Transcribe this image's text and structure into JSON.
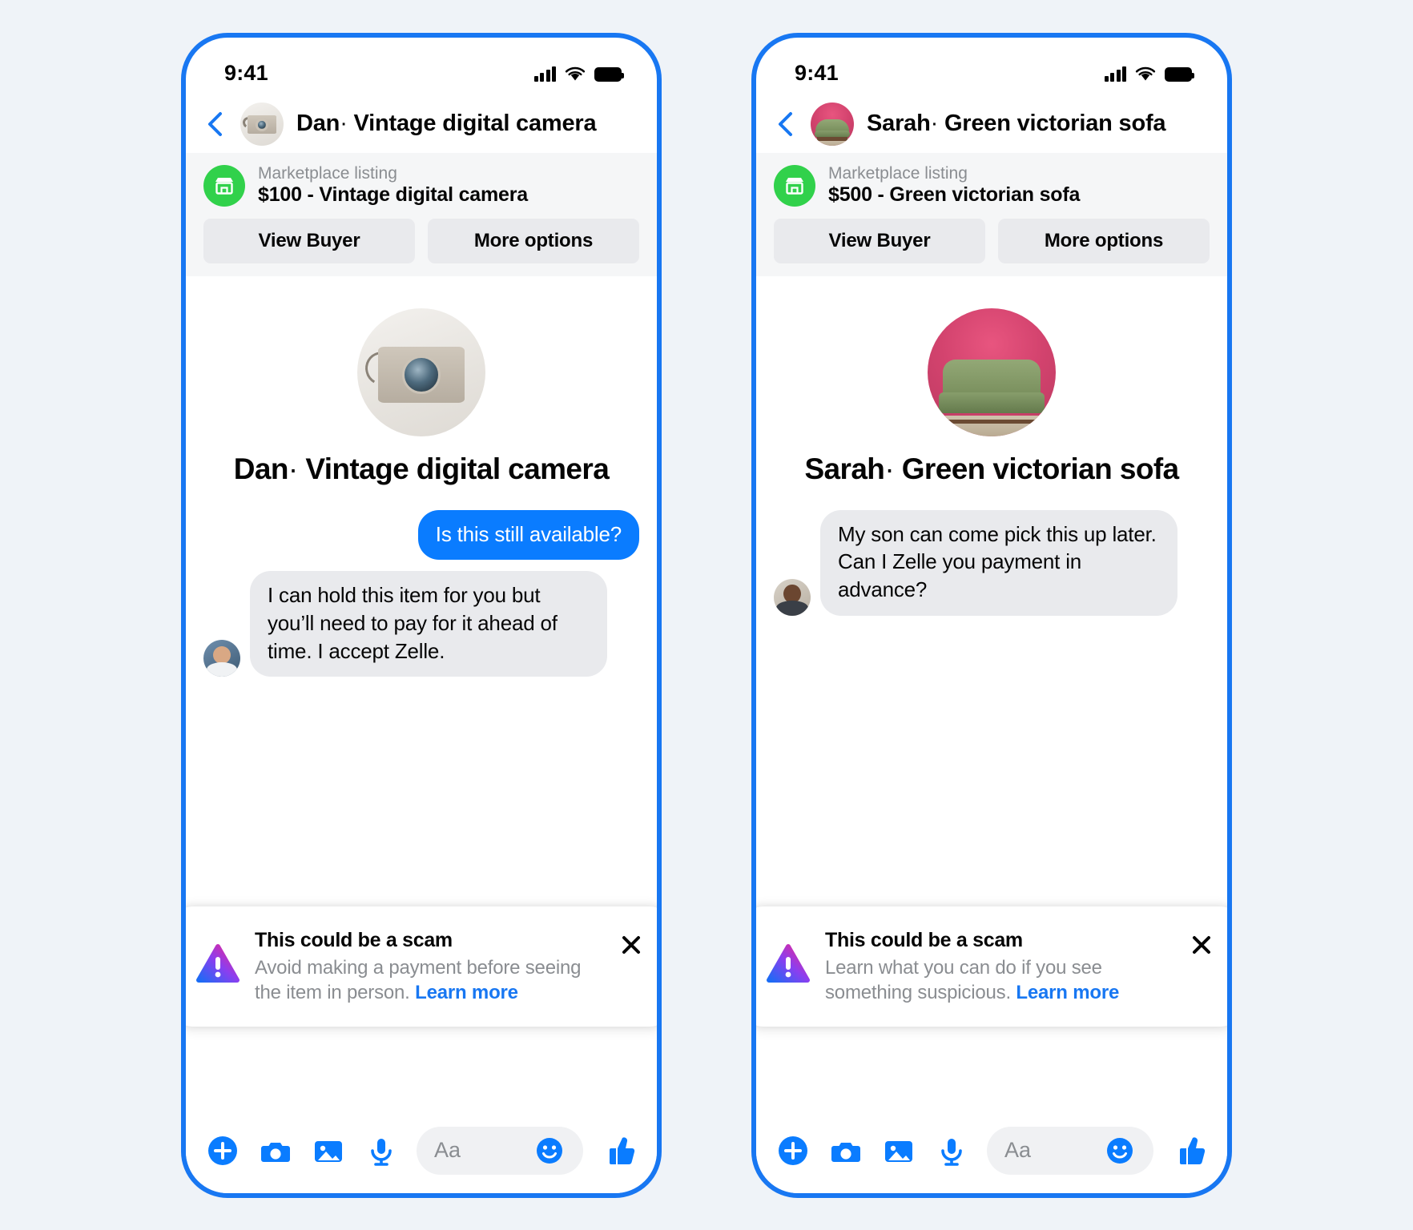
{
  "theme": {
    "page_bg": "#eff3f8",
    "frame_blue": "#1877f2",
    "bubble_out_blue": "#0a7cff",
    "bubble_in_grey": "#e9eaed",
    "marketplace_green": "#31d14b",
    "link_blue": "#1877f2",
    "muted_text": "#8a8d91"
  },
  "phones": [
    {
      "status": {
        "time": "9:41",
        "signal_icon": "cellular-signal-icon",
        "wifi_icon": "wifi-icon",
        "battery_icon": "battery-full-icon"
      },
      "header": {
        "back_icon": "back-chevron-icon",
        "avatar_icon": "vintage-camera-thumbnail",
        "name": "Dan",
        "separator": "·",
        "item": "Vintage digital camera"
      },
      "marketplace": {
        "badge_icon": "marketplace-storefront-icon",
        "label": "Marketplace listing",
        "price_line": "$100 - Vintage digital camera",
        "buttons": [
          {
            "label": "View Buyer",
            "name": "view-buyer-button"
          },
          {
            "label": "More options",
            "name": "more-options-button"
          }
        ]
      },
      "thread": {
        "avatar_icon": "vintage-camera-large-thumbnail",
        "name": "Dan",
        "separator": "·",
        "item": "Vintage digital camera",
        "messages": [
          {
            "direction": "out",
            "text": "Is this still available?",
            "avatar_icon": null
          },
          {
            "direction": "in",
            "text": "I can hold this item for you but you’ll need to pay for it ahead of time. I accept Zelle.",
            "avatar_icon": "dan-avatar"
          }
        ]
      },
      "warning": {
        "icon": "warning-triangle-icon",
        "title": "This could be a scam",
        "body": "Avoid making a payment before seeing the item in person.",
        "link": "Learn more",
        "close_icon": "close-icon"
      },
      "composer": {
        "icons": [
          {
            "name": "add-plus-icon"
          },
          {
            "name": "camera-icon"
          },
          {
            "name": "photo-gallery-icon"
          },
          {
            "name": "microphone-icon"
          }
        ],
        "input_placeholder": "Aa",
        "emoji_icon": "emoji-smiley-icon",
        "thumbs_icon": "thumbs-up-icon"
      }
    },
    {
      "status": {
        "time": "9:41",
        "signal_icon": "cellular-signal-icon",
        "wifi_icon": "wifi-icon",
        "battery_icon": "battery-full-icon"
      },
      "header": {
        "back_icon": "back-chevron-icon",
        "avatar_icon": "green-sofa-thumbnail",
        "name": "Sarah",
        "separator": "·",
        "item": "Green victorian sofa"
      },
      "marketplace": {
        "badge_icon": "marketplace-storefront-icon",
        "label": "Marketplace listing",
        "price_line": "$500 - Green victorian sofa",
        "buttons": [
          {
            "label": "View Buyer",
            "name": "view-buyer-button"
          },
          {
            "label": "More options",
            "name": "more-options-button"
          }
        ]
      },
      "thread": {
        "avatar_icon": "green-sofa-large-thumbnail",
        "name": "Sarah",
        "separator": "·",
        "item": "Green victorian sofa",
        "messages": [
          {
            "direction": "in",
            "text": "My son can come pick this up later. Can I Zelle you payment in advance?",
            "avatar_icon": "sarah-avatar"
          }
        ]
      },
      "warning": {
        "icon": "warning-triangle-icon",
        "title": "This could be a scam",
        "body": "Learn what you can do if you see something suspicious.",
        "link": "Learn more",
        "close_icon": "close-icon"
      },
      "composer": {
        "icons": [
          {
            "name": "add-plus-icon"
          },
          {
            "name": "camera-icon"
          },
          {
            "name": "photo-gallery-icon"
          },
          {
            "name": "microphone-icon"
          }
        ],
        "input_placeholder": "Aa",
        "emoji_icon": "emoji-smiley-icon",
        "thumbs_icon": "thumbs-up-icon"
      }
    }
  ]
}
